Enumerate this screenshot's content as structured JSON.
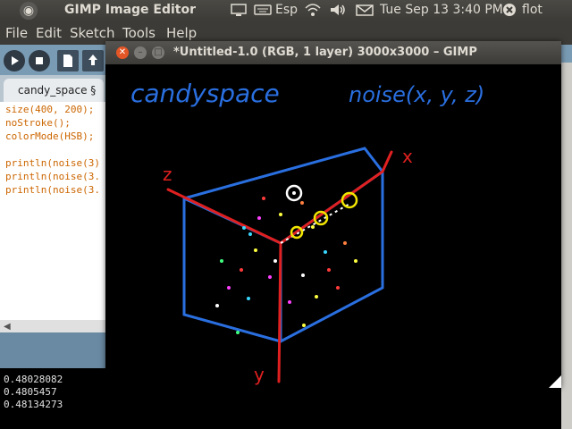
{
  "top_panel": {
    "app_title": "GIMP Image Editor",
    "keyboard_layout": "Esp",
    "clock": "Tue Sep 13  3:40 PM",
    "user": "flot"
  },
  "processing": {
    "menu": [
      "File",
      "Edit",
      "Sketch",
      "Tools",
      "Help"
    ],
    "tab_label": "candy_space §",
    "code_lines": [
      "size(400, 200);",
      "noStroke();",
      "colorMode(HSB);",
      "",
      "println(noise(3)",
      "println(noise(3.",
      "println(noise(3."
    ],
    "console_lines": [
      "0.48028082",
      "0.4805457",
      "0.48134273"
    ]
  },
  "gimp": {
    "title": "*Untitled-1.0 (RGB, 1 layer) 3000x3000 – GIMP",
    "canvas_text": {
      "heading": "candyspace",
      "formula": "noise(x, y, z)",
      "axis_x": "x",
      "axis_y": "y",
      "axis_z": "z"
    }
  },
  "icons": [
    "ubuntu-logo",
    "display-icon",
    "keyboard-icon",
    "wifi-icon",
    "volume-icon",
    "mail-icon",
    "power-icon"
  ]
}
